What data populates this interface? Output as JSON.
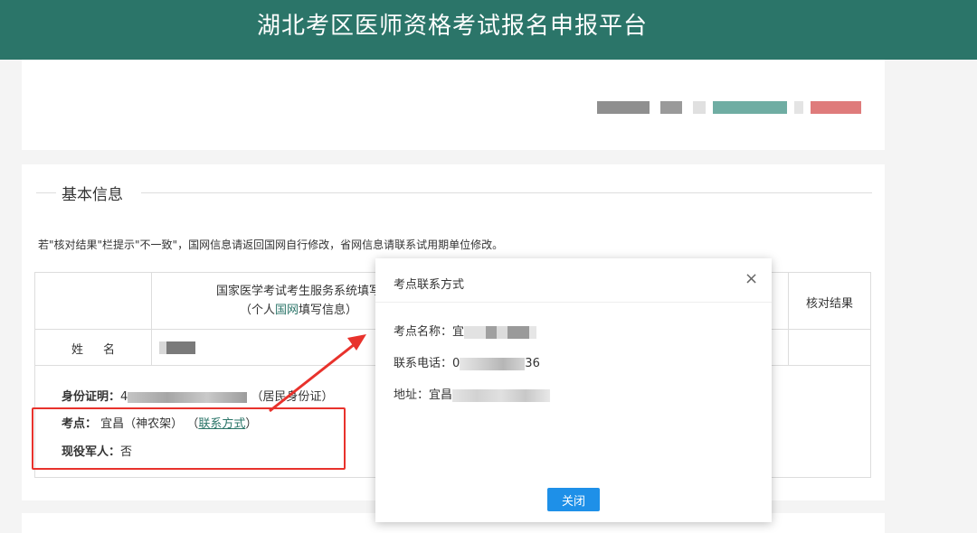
{
  "header": {
    "title": "湖北考区医师资格考试报名申报平台"
  },
  "section": {
    "title": "基本信息"
  },
  "notice": "若\"核对结果\"栏提示\"不一致\"，国网信息请返回国网自行修改，省网信息请联系试用期单位修改。",
  "table": {
    "national_header_line1": "国家医学考试考生服务系统填写",
    "national_header_pre": "（个人",
    "national_header_em": "国网",
    "national_header_post": "填写信息）",
    "result_header": "核对结果",
    "name_label": "姓名"
  },
  "info": {
    "id_label": "身份证明：",
    "id_prefix": "4",
    "id_type": "（居民身份证）",
    "site_label": "考点：",
    "site_value": "宜昌（神农架）",
    "site_link_open": "（",
    "site_link": "联系方式",
    "site_link_close": "）",
    "army_label": "现役军人：",
    "army_value": "否"
  },
  "dialog": {
    "title": "考点联系方式",
    "close": "×",
    "name_label": "考点名称：",
    "name_prefix": "宜",
    "phone_label": "联系电话：",
    "phone_prefix": "0",
    "phone_suffix": "36",
    "address_label": "地址：",
    "address_prefix": "宜昌",
    "close_button": "关闭"
  },
  "colors": {
    "header_bg": "#2b7569",
    "accent_link": "#2b7569",
    "button_bg": "#1e90e8",
    "highlight_red": "#e8322c"
  }
}
